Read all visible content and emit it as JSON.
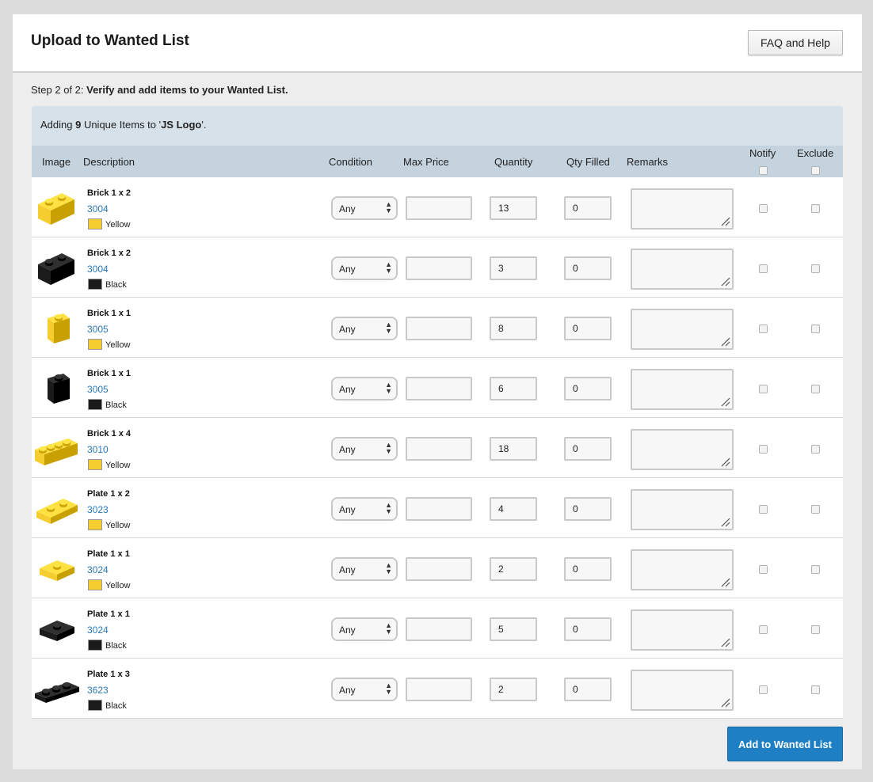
{
  "header": {
    "title": "Upload to Wanted List",
    "faq_label": "FAQ and Help"
  },
  "step": {
    "prefix": "Step 2 of 2:",
    "text": " Verify and add items to your Wanted List."
  },
  "summary": {
    "pre": "Adding ",
    "count": "9",
    "mid": " Unique Items to '",
    "list_name": "JS Logo",
    "post": "'."
  },
  "columns": {
    "image": "Image",
    "description": "Description",
    "condition": "Condition",
    "max_price": "Max Price",
    "quantity": "Quantity",
    "qty_filled": "Qty Filled",
    "remarks": "Remarks",
    "notify": "Notify",
    "exclude": "Exclude"
  },
  "colors": {
    "Yellow": "#f5cd2f",
    "Black": "#1b1b1b",
    "link": "#2a78b8",
    "accent": "#1f7fc4"
  },
  "items": [
    {
      "name": "Brick 1 x 2",
      "id": "3004",
      "color": "Yellow",
      "shape": "brick-1x2",
      "condition": "Any",
      "max_price": "",
      "quantity": "13",
      "qty_filled": "0"
    },
    {
      "name": "Brick 1 x 2",
      "id": "3004",
      "color": "Black",
      "shape": "brick-1x2",
      "condition": "Any",
      "max_price": "",
      "quantity": "3",
      "qty_filled": "0"
    },
    {
      "name": "Brick 1 x 1",
      "id": "3005",
      "color": "Yellow",
      "shape": "brick-1x1",
      "condition": "Any",
      "max_price": "",
      "quantity": "8",
      "qty_filled": "0"
    },
    {
      "name": "Brick 1 x 1",
      "id": "3005",
      "color": "Black",
      "shape": "brick-1x1",
      "condition": "Any",
      "max_price": "",
      "quantity": "6",
      "qty_filled": "0"
    },
    {
      "name": "Brick 1 x 4",
      "id": "3010",
      "color": "Yellow",
      "shape": "brick-1x4",
      "condition": "Any",
      "max_price": "",
      "quantity": "18",
      "qty_filled": "0"
    },
    {
      "name": "Plate 1 x 2",
      "id": "3023",
      "color": "Yellow",
      "shape": "plate-1x2",
      "condition": "Any",
      "max_price": "",
      "quantity": "4",
      "qty_filled": "0"
    },
    {
      "name": "Plate 1 x 1",
      "id": "3024",
      "color": "Yellow",
      "shape": "plate-1x1",
      "condition": "Any",
      "max_price": "",
      "quantity": "2",
      "qty_filled": "0"
    },
    {
      "name": "Plate 1 x 1",
      "id": "3024",
      "color": "Black",
      "shape": "plate-1x1",
      "condition": "Any",
      "max_price": "",
      "quantity": "5",
      "qty_filled": "0"
    },
    {
      "name": "Plate 1 x 3",
      "id": "3623",
      "color": "Black",
      "shape": "plate-1x3",
      "condition": "Any",
      "max_price": "",
      "quantity": "2",
      "qty_filled": "0"
    }
  ],
  "submit_label": "Add to Wanted List"
}
